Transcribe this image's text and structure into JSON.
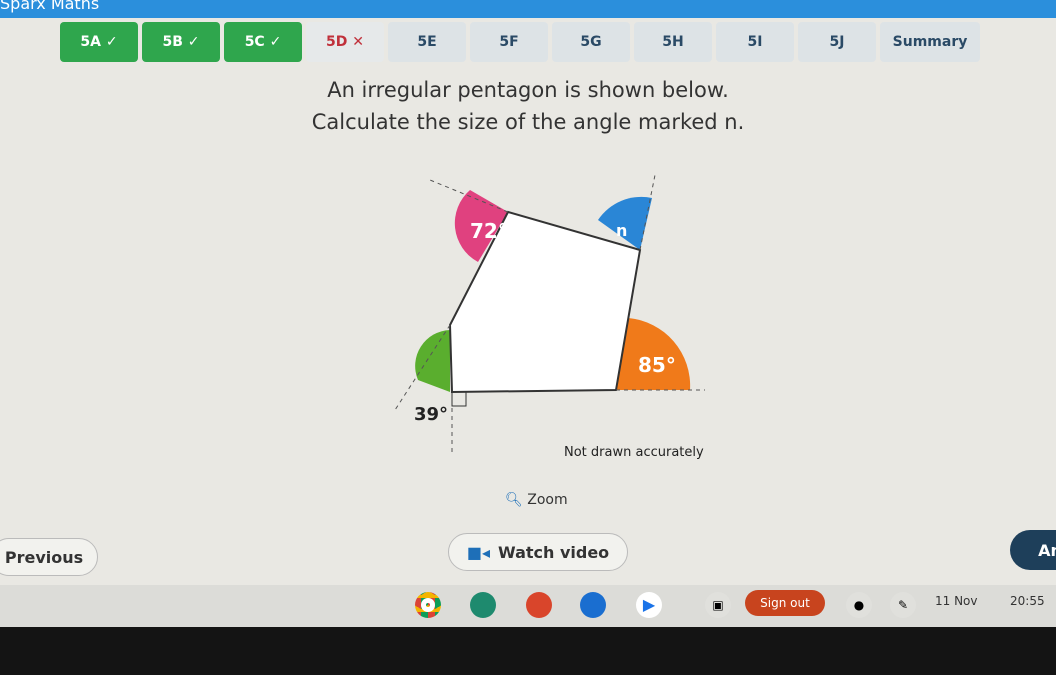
{
  "brand": "Sparx Maths",
  "tabs": [
    {
      "label": "5A ✓",
      "state": "correct"
    },
    {
      "label": "5B ✓",
      "state": "correct"
    },
    {
      "label": "5C ✓",
      "state": "correct"
    },
    {
      "label": "5D ✕",
      "state": "wrong"
    },
    {
      "label": "5E"
    },
    {
      "label": "5F"
    },
    {
      "label": "5G"
    },
    {
      "label": "5H"
    },
    {
      "label": "5I"
    },
    {
      "label": "5J"
    },
    {
      "label": "Summary"
    }
  ],
  "question": {
    "line1": "An irregular pentagon is shown below.",
    "line2": "Calculate the size of the angle marked n."
  },
  "diagram": {
    "angle_a": "72°",
    "angle_n": "n",
    "angle_c": "85°",
    "angle_d": "39°",
    "note": "Not drawn accurately",
    "colors": {
      "pink": "#e0417f",
      "blue": "#2a86d6",
      "orange": "#f07a1a",
      "green": "#5aae2e"
    }
  },
  "zoom_label": "Zoom",
  "buttons": {
    "previous": "Previous",
    "watch_video": "Watch video",
    "answer": "An"
  },
  "shelf": {
    "sign_out": "Sign out",
    "date": "11 Nov",
    "time": "20:55"
  }
}
